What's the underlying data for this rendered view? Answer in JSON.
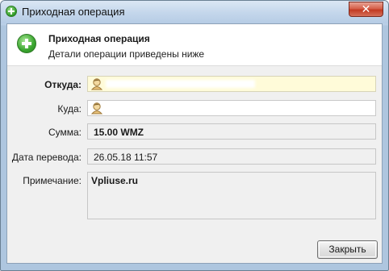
{
  "window": {
    "title": "Приходная операция",
    "close_glyph": "✕"
  },
  "header": {
    "title": "Приходная операция",
    "subtitle": "Детали операции приведены ниже",
    "icon": "plus-circle-icon"
  },
  "form": {
    "from_label": "Откуда:",
    "to_label": "Куда:",
    "amount_label": "Сумма:",
    "amount_value": "15.00 WMZ",
    "date_label": "Дата перевода:",
    "date_value": "26.05.18 11:57",
    "note_label": "Примечание:",
    "note_value": "Vpliuse.ru"
  },
  "buttons": {
    "close_label": "Закрыть"
  },
  "colors": {
    "accent_green": "#3aa52f",
    "from_field_bg": "#fffbd9",
    "close_red": "#c23a22"
  }
}
